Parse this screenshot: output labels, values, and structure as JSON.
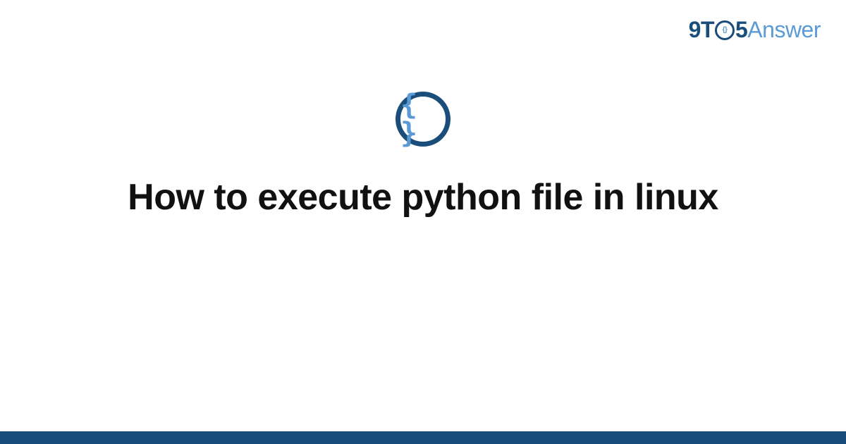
{
  "logo": {
    "prefix": "9T",
    "clock_inner": "{}",
    "middle": "5",
    "suffix": "Answer"
  },
  "icon": {
    "braces": "{ }"
  },
  "title": "How to execute python file in linux",
  "colors": {
    "dark_blue": "#1b4d7a",
    "light_blue": "#5b9bd5",
    "text": "#111111",
    "background": "#ffffff"
  }
}
